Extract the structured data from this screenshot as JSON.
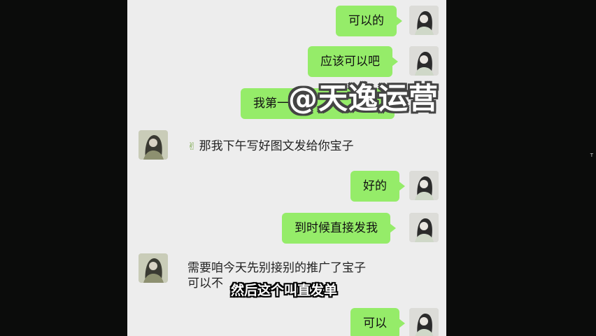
{
  "side_mark": "T",
  "messages": [
    {
      "id": "m1",
      "direction": "out",
      "text": "可以的"
    },
    {
      "id": "m2",
      "direction": "out",
      "text": "应该可以吧"
    },
    {
      "id": "m3",
      "direction": "out",
      "text": "我第一"
    },
    {
      "id": "m4",
      "direction": "in",
      "emoji": "✌",
      "emoji_name": "victory-hand-icon",
      "text": "那我下午写好图文发给你宝子"
    },
    {
      "id": "m5",
      "direction": "out",
      "text": "好的"
    },
    {
      "id": "m6",
      "direction": "out",
      "text": "到时候直接发我"
    },
    {
      "id": "m7",
      "direction": "in",
      "line1": "需要咱今天先别接别的推广了宝子",
      "line2": "可以不"
    },
    {
      "id": "m8",
      "direction": "out",
      "text": "可以"
    }
  ],
  "overlay": {
    "watermark": "@天逸运营",
    "caption": "然后这个叫直发单"
  },
  "colors": {
    "outgoing_bubble": "#95ec69",
    "chat_background": "#ededed",
    "page_background": "#0b0c0b"
  }
}
